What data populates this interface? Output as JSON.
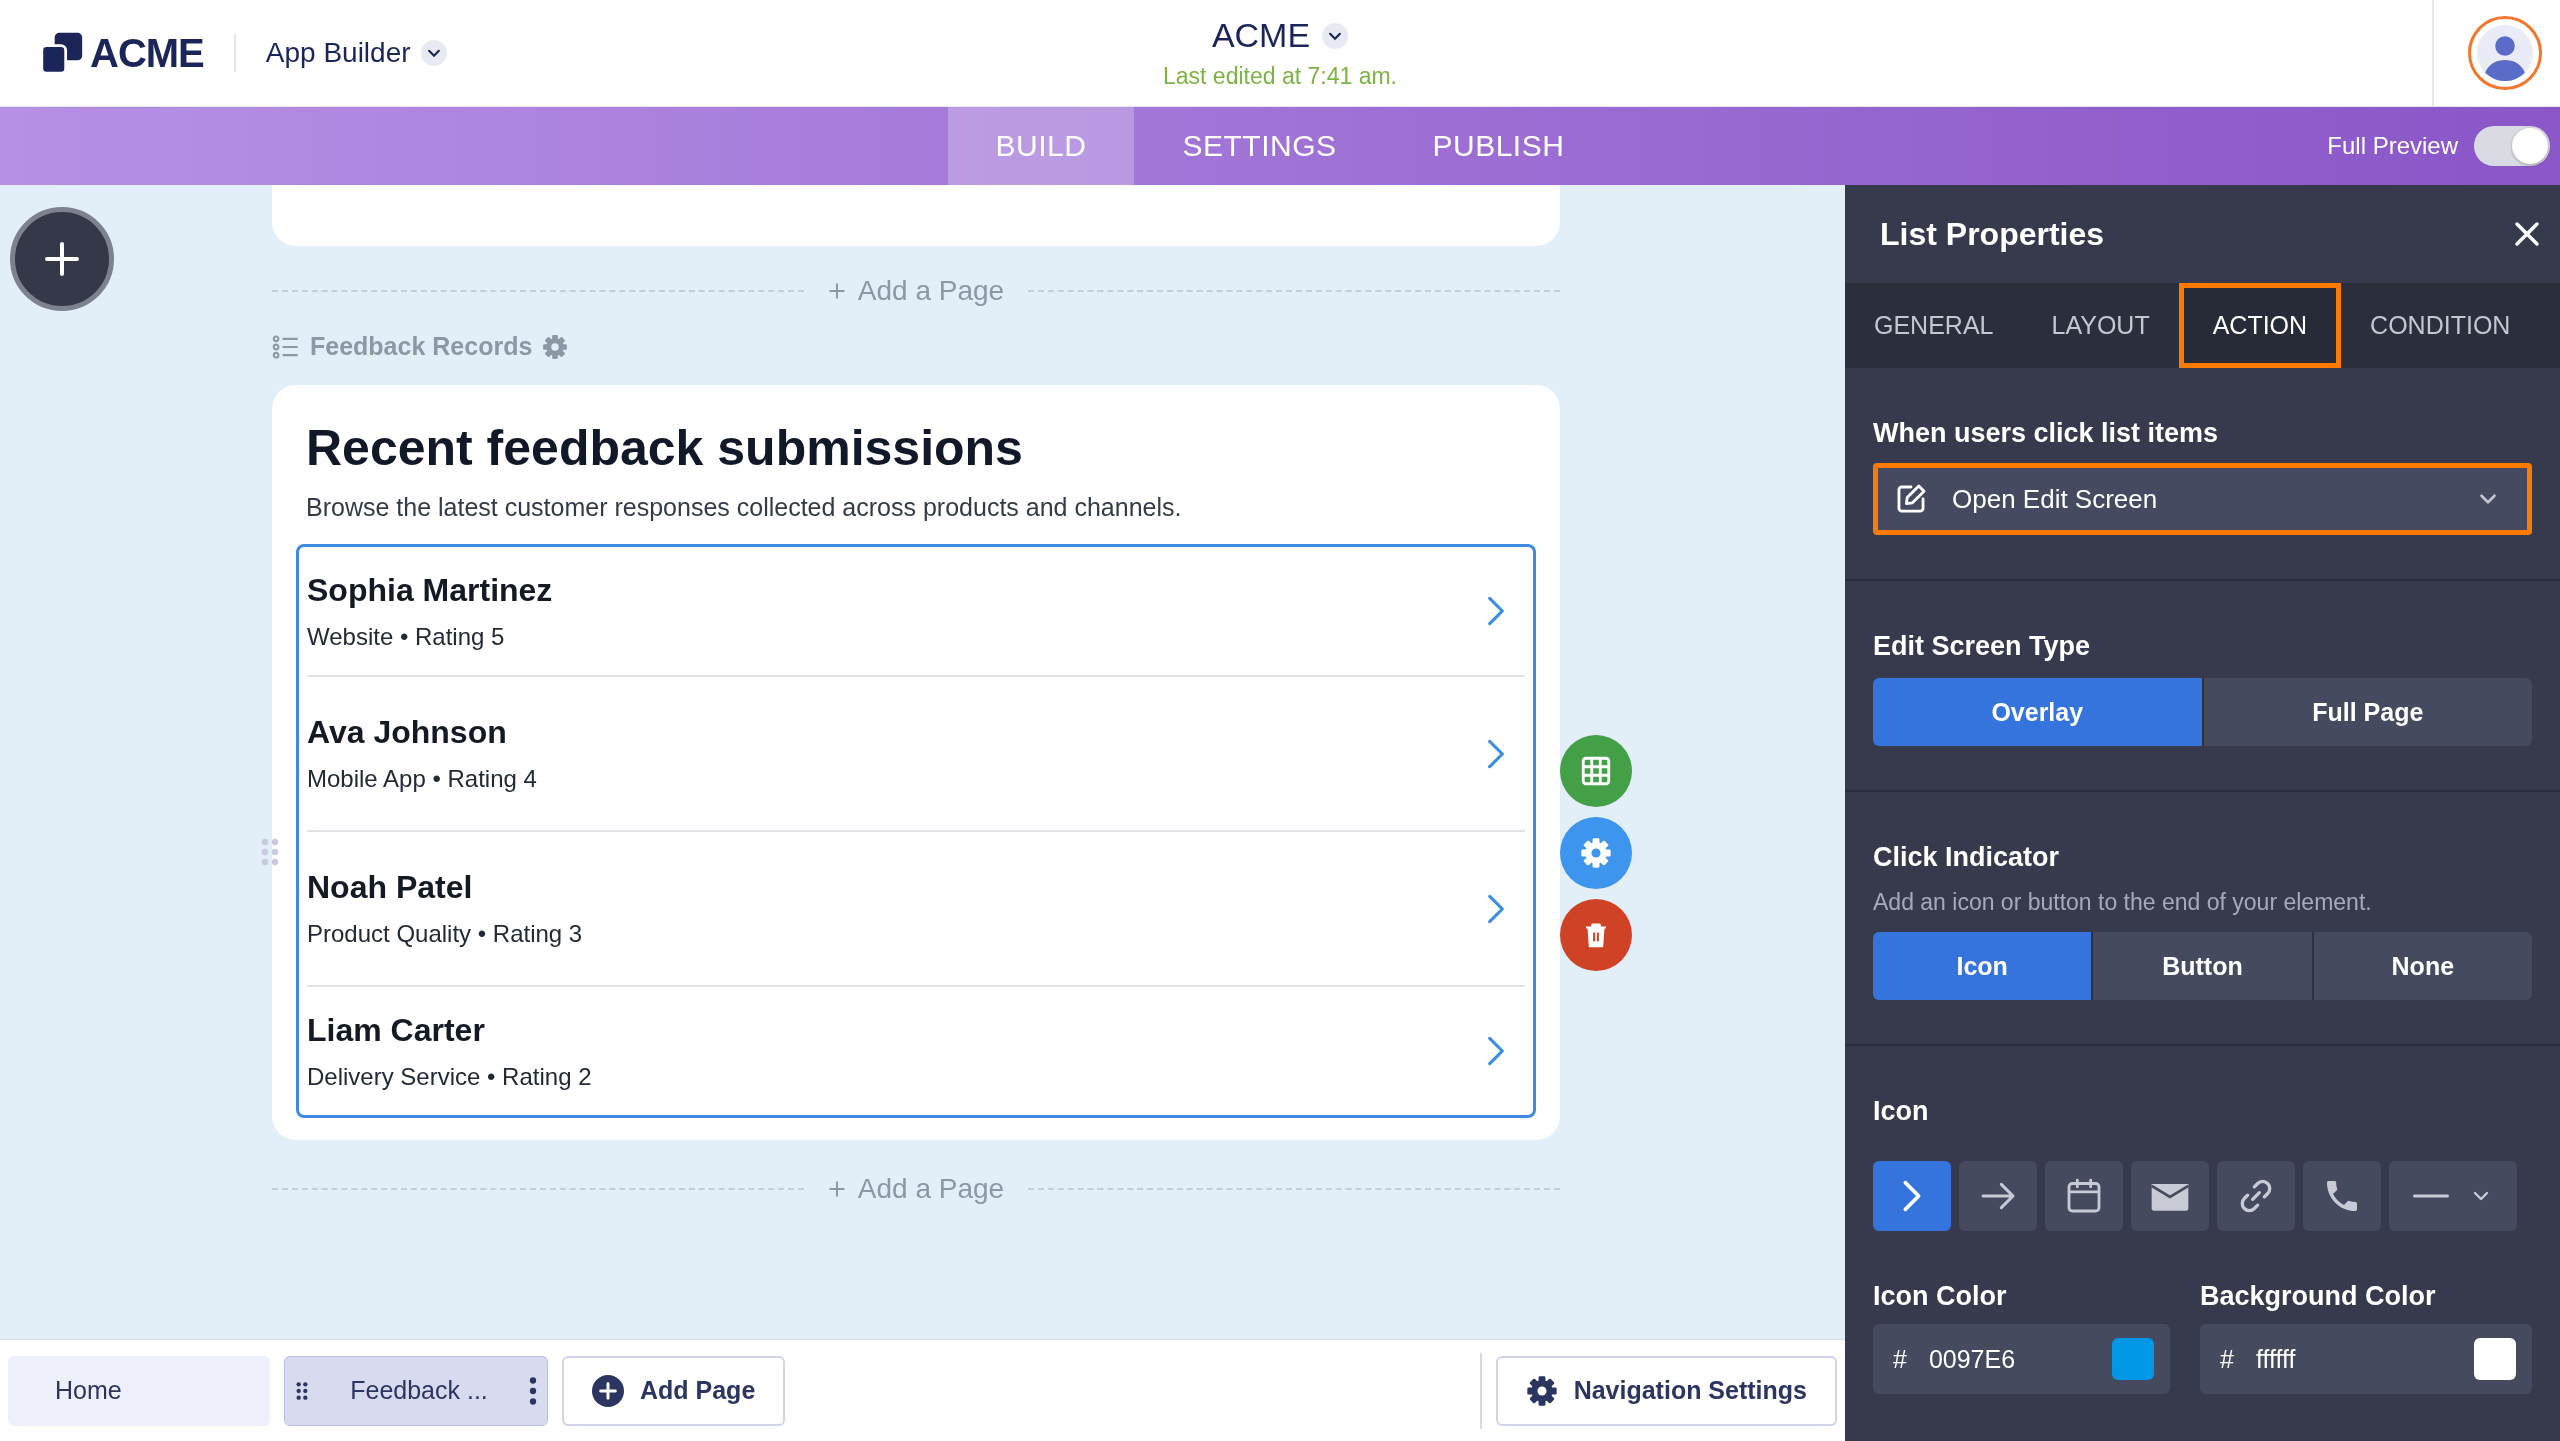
{
  "header": {
    "logo": "ACME",
    "app_menu": "App Builder",
    "app_title": "ACME",
    "last_edited": "Last edited at 7:41 am."
  },
  "nav_tabs": [
    {
      "label": "BUILD",
      "selected": true
    },
    {
      "label": "SETTINGS",
      "selected": false
    },
    {
      "label": "PUBLISH",
      "selected": false
    }
  ],
  "full_preview": {
    "label": "Full Preview",
    "on": true
  },
  "canvas": {
    "add_page_top": "Add a Page",
    "list_label": "Feedback Records",
    "card": {
      "title": "Recent feedback submissions",
      "description": "Browse the latest customer responses collected across products and channels.",
      "items": [
        {
          "name": "Sophia Martinez",
          "detail": "Website • Rating 5"
        },
        {
          "name": "Ava Johnson",
          "detail": "Mobile App • Rating 4"
        },
        {
          "name": "Noah Patel",
          "detail": "Product Quality • Rating 3"
        },
        {
          "name": "Liam Carter",
          "detail": "Delivery Service • Rating 2"
        }
      ]
    },
    "add_page_bottom": "Add a Page"
  },
  "bottom_bar": {
    "pages": [
      {
        "label": "Home",
        "selected": false
      },
      {
        "label": "Feedback ...",
        "selected": true
      }
    ],
    "add_page": "Add Page",
    "navigation_settings": "Navigation Settings"
  },
  "panel": {
    "title": "List Properties",
    "tabs": [
      {
        "label": "GENERAL",
        "selected": false,
        "highlighted": false
      },
      {
        "label": "LAYOUT",
        "selected": false,
        "highlighted": false
      },
      {
        "label": "ACTION",
        "selected": true,
        "highlighted": true
      },
      {
        "label": "CONDITION",
        "selected": false,
        "highlighted": false
      }
    ],
    "click_action": {
      "label": "When users click list items",
      "value": "Open Edit Screen",
      "highlighted": true
    },
    "edit_screen_type": {
      "label": "Edit Screen Type",
      "options": [
        {
          "label": "Overlay",
          "selected": true
        },
        {
          "label": "Full Page",
          "selected": false
        }
      ]
    },
    "click_indicator": {
      "label": "Click Indicator",
      "description": "Add an icon or button to the end of your element.",
      "options": [
        {
          "label": "Icon",
          "selected": true
        },
        {
          "label": "Button",
          "selected": false
        },
        {
          "label": "None",
          "selected": false
        }
      ]
    },
    "icon_picker": {
      "label": "Icon",
      "options": [
        {
          "kind": "chevron",
          "selected": true
        },
        {
          "kind": "arrow",
          "selected": false
        },
        {
          "kind": "calendar",
          "selected": false
        },
        {
          "kind": "envelope",
          "selected": false
        },
        {
          "kind": "link",
          "selected": false
        },
        {
          "kind": "phone",
          "selected": false
        },
        {
          "kind": "dash",
          "selected": false
        }
      ]
    },
    "icon_color": {
      "label": "Icon Color",
      "hash": "#",
      "value": "0097E6"
    },
    "background_color": {
      "label": "Background Color",
      "hash": "#",
      "value": "ffffff"
    }
  }
}
